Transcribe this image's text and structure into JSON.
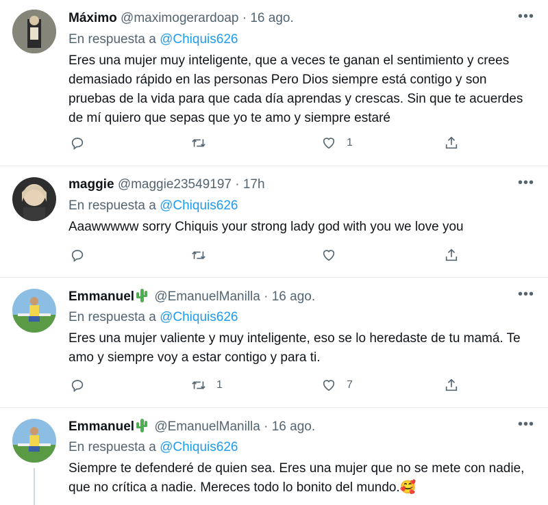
{
  "tweets": [
    {
      "name": "Máximo",
      "handle": "@maximogerardoap",
      "dot": "·",
      "time": "16 ago.",
      "reply_prefix": "En respuesta a",
      "reply_to": "@Chiquis626",
      "text": "Eres una mujer muy inteligente, que a veces te ganan el sentimiento y crees demasiado rápido en las personas Pero  Dios siempre está contigo y son pruebas de la vida para que cada día aprendas y crescas. Sin que te acuerdes de mí quiero que sepas que yo te amo y siempre estaré",
      "replies": "",
      "retweets": "",
      "likes": "1",
      "more": "•••",
      "avatar_colors": [
        "#7a7a6e",
        "#2b2b2b"
      ]
    },
    {
      "name": "maggie",
      "handle": "@maggie23549197",
      "dot": "·",
      "time": "17h",
      "reply_prefix": "En respuesta a",
      "reply_to": "@Chiquis626",
      "text": "Aaawwwww sorry Chiquis your strong lady god with you we love you",
      "replies": "",
      "retweets": "",
      "likes": "",
      "more": "•••",
      "avatar_colors": [
        "#c9b59a",
        "#3a3a3a"
      ]
    },
    {
      "name": "Emmanuel",
      "handle": "@EmanuelManilla",
      "dot": "·",
      "time": "16 ago.",
      "reply_prefix": "En respuesta a",
      "reply_to": "@Chiquis626",
      "text": "Eres una mujer valiente y muy inteligente, eso se lo heredaste de tu mamá. Te amo y siempre voy a estar contigo y para ti.",
      "replies": "",
      "retweets": "1",
      "likes": "7",
      "more": "•••",
      "avatar_colors": [
        "#7fb2d9",
        "#4f8a3c"
      ]
    },
    {
      "name": "Emmanuel",
      "handle": "@EmanuelManilla",
      "dot": "·",
      "time": "16 ago.",
      "reply_prefix": "En respuesta a",
      "reply_to": "@Chiquis626",
      "text": "Siempre te defenderé de quien sea. Eres una mujer que no se mete con nadie, que no crítica a nadie. Mereces todo lo bonito del mundo.",
      "emoji": "🥰",
      "replies": "",
      "retweets": "",
      "likes": "",
      "more": "•••",
      "avatar_colors": [
        "#7fb2d9",
        "#4f8a3c"
      ]
    }
  ],
  "colors": {
    "accent": "#1d9bf0",
    "secondary_text": "#536471",
    "divider": "#e6ecf0",
    "cactus": "#4caf50"
  },
  "icons": [
    "reply-icon",
    "retweet-icon",
    "like-icon",
    "share-icon",
    "more-icon",
    "cactus-emoji"
  ]
}
